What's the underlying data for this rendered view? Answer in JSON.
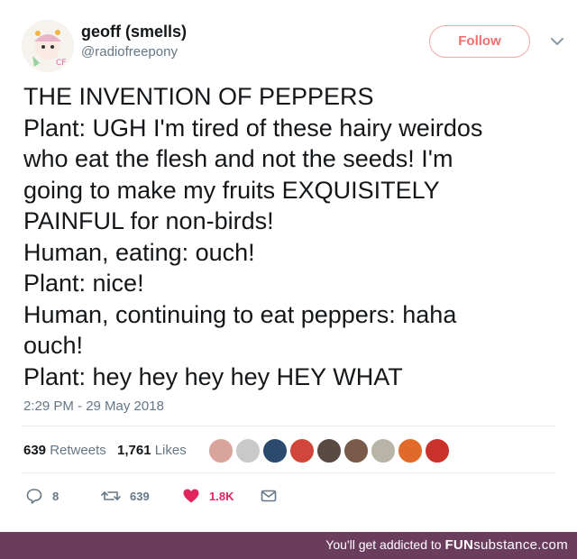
{
  "user": {
    "display_name": "geoff (smells)",
    "handle": "@radiofreepony"
  },
  "follow_button": {
    "label": "Follow"
  },
  "tweet": {
    "lines": [
      "THE INVENTION OF PEPPERS",
      "Plant: UGH I'm tired of these hairy weirdos",
      "who eat the flesh and not the seeds! I'm",
      "going to make my fruits EXQUISITELY",
      "PAINFUL for non-birds!",
      "Human, eating: ouch!",
      "Plant: nice!",
      "Human, continuing to eat peppers: haha",
      "ouch!",
      "Plant: hey hey hey hey HEY WHAT"
    ],
    "timestamp": "2:29 PM - 29 May 2018"
  },
  "stats": {
    "retweets_count": "639",
    "retweets_label": "Retweets",
    "likes_count": "1,761",
    "likes_label": "Likes",
    "liker_avatar_colors": [
      "#d9a59a",
      "#c9c9c9",
      "#2b4a6e",
      "#d0463a",
      "#5a4a44",
      "#7a5a48",
      "#b8b4a8",
      "#e06a2a",
      "#c8322a"
    ]
  },
  "actions": {
    "reply_count": "8",
    "retweet_count": "639",
    "like_count": "1.8K"
  },
  "footer": {
    "tagline": "You'll get addicted to",
    "brand_fun": "FUN",
    "brand_sub": "substance",
    "brand_tld": ".com"
  },
  "colors": {
    "follow_accent": "#f07070",
    "like_accent": "#e0245e",
    "footer_bg": "#6b3d5c",
    "secondary_text": "#657786"
  }
}
